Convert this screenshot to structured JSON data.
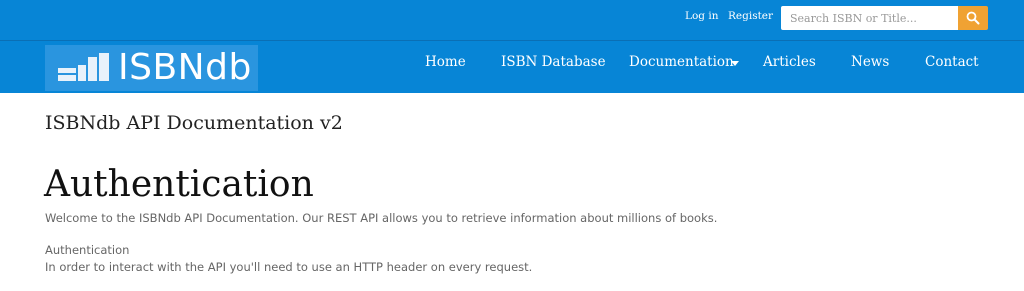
{
  "topbar": {
    "login_label": "Log in",
    "register_label": "Register",
    "search_placeholder": "Search ISBN or Title...",
    "search_icon": "search-icon"
  },
  "navbar": {
    "logo_text": "ISBNdb",
    "items": [
      {
        "label": "Home"
      },
      {
        "label": "ISBN Database"
      },
      {
        "label": "Documentation",
        "has_dropdown": true
      },
      {
        "label": "Articles"
      },
      {
        "label": "News"
      },
      {
        "label": "Contact"
      }
    ]
  },
  "content": {
    "doc_title": "ISBNdb API Documentation v2",
    "heading": "Authentication",
    "intro": "Welcome to the ISBNdb API Documentation. Our REST API allows you to retrieve information about millions of books.",
    "auth_label": "Authentication",
    "auth_text": "In order to interact with the API you'll need to use an HTTP header on every request."
  },
  "colors": {
    "brand_blue": "#0785d6",
    "search_button": "#f0a233"
  }
}
